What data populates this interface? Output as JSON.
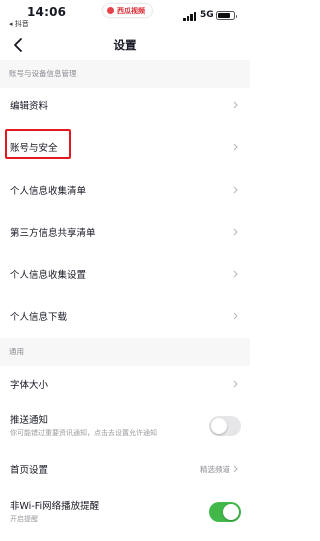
{
  "status_bar": {
    "time": "14:06",
    "back_app": "◂ 抖音",
    "app_pill": "西瓜视频",
    "network": "5G"
  },
  "header": {
    "title": "设置",
    "back_icon": "chevron-left-icon"
  },
  "sections": [
    {
      "header": "账号与设备信息管理",
      "items": [
        {
          "label": "编辑资料"
        },
        {
          "label": "账号与安全"
        },
        {
          "label": "个人信息收集清单"
        },
        {
          "label": "第三方信息共享清单"
        },
        {
          "label": "个人信息收集设置"
        },
        {
          "label": "个人信息下载"
        }
      ]
    },
    {
      "header": "通用",
      "items": [
        {
          "label": "字体大小"
        },
        {
          "label": "推送通知",
          "subtitle": "你可能错过重要资讯通知，点击去设置允许通知",
          "toggle": false
        },
        {
          "label": "首页设置",
          "value": "精选频道"
        },
        {
          "label": "非Wi-Fi网络播放提醒",
          "subtitle": "开启提醒",
          "toggle": true
        }
      ]
    }
  ],
  "colors": {
    "highlight": "#e3191f",
    "toggle_on": "#43b84a",
    "toggle_off": "#e6e6e9",
    "section_bg": "#f7f7f8"
  }
}
